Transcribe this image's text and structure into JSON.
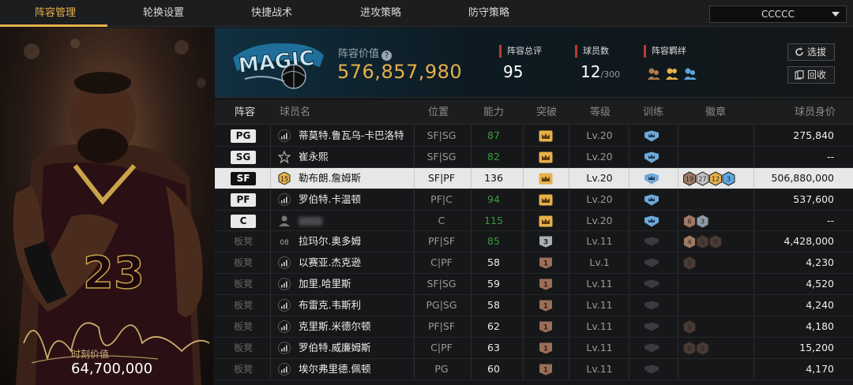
{
  "nav": {
    "tabs": [
      "阵容管理",
      "轮换设置",
      "快捷战术",
      "进攻策略",
      "防守策略"
    ],
    "active_tab": 0,
    "team_select": "CCCCC"
  },
  "featured_player": {
    "jersey": "23",
    "value_label": "时刻价值",
    "value": "64,700,000"
  },
  "header": {
    "logo_text": "MAGIC",
    "value_label": "阵容价值",
    "value": "576,857,980",
    "stats": [
      {
        "label": "阵容总评",
        "value": "95",
        "sub": ""
      },
      {
        "label": "球员数",
        "value": "12",
        "sub": "/300"
      },
      {
        "label": "阵容羁绊",
        "value": "",
        "sub": ""
      }
    ],
    "buttons": {
      "select": "选拔",
      "recycle": "回收"
    }
  },
  "table": {
    "columns": [
      "阵容",
      "球员名",
      "位置",
      "能力",
      "突破",
      "等级",
      "训练",
      "徽章",
      "球员身价"
    ],
    "rows": [
      {
        "slot": "PG",
        "bench": false,
        "name": "蒂莫特.鲁瓦乌-卡巴洛特",
        "pos": "SF|SG",
        "ability": "87",
        "ability_color": "green",
        "breakthrough": "crown",
        "level": "Lv.20",
        "trained": true,
        "badges": [],
        "price": "275,840"
      },
      {
        "slot": "SG",
        "bench": false,
        "name": "崔永熙",
        "pos": "SF|SG",
        "ability": "82",
        "ability_color": "green",
        "breakthrough": "crown",
        "level": "Lv.20",
        "trained": true,
        "badges": [],
        "price": "--"
      },
      {
        "slot": "SF",
        "bench": false,
        "name": "勒布朗.詹姆斯",
        "pos": "SF|PF",
        "ability": "136",
        "ability_color": "white",
        "breakthrough": "crown",
        "level": "Lv.20",
        "trained": true,
        "badges": [
          "19",
          "27",
          "12",
          "3"
        ],
        "price": "506,880,000",
        "selected": true
      },
      {
        "slot": "PF",
        "bench": false,
        "name": "罗伯特.卡温顿",
        "pos": "PF|C",
        "ability": "94",
        "ability_color": "green",
        "breakthrough": "crown",
        "level": "Lv.20",
        "trained": true,
        "badges": [],
        "price": "537,600"
      },
      {
        "slot": "C",
        "bench": false,
        "name": "",
        "pos": "C",
        "ability": "115",
        "ability_color": "green",
        "breakthrough": "crown",
        "level": "Lv.20",
        "trained": true,
        "badges": [
          "6",
          "3"
        ],
        "price": "--"
      },
      {
        "slot": "板凳",
        "bench": true,
        "name": "拉玛尔.奥多姆",
        "pos": "PF|SF",
        "ability": "85",
        "ability_color": "green",
        "breakthrough": "3",
        "level": "Lv.11",
        "trained": false,
        "badges": [
          "4",
          "0",
          "0"
        ],
        "price": "4,428,000",
        "icon_text": "08"
      },
      {
        "slot": "板凳",
        "bench": true,
        "name": "以赛亚.杰克逊",
        "pos": "C|PF",
        "ability": "58",
        "ability_color": "white",
        "breakthrough": "1",
        "level": "Lv.1",
        "trained": false,
        "badges": [
          "0"
        ],
        "price": "4,230"
      },
      {
        "slot": "板凳",
        "bench": true,
        "name": "加里.哈里斯",
        "pos": "SF|SG",
        "ability": "59",
        "ability_color": "white",
        "breakthrough": "1",
        "level": "Lv.11",
        "trained": false,
        "badges": [],
        "price": "4,520"
      },
      {
        "slot": "板凳",
        "bench": true,
        "name": "布雷克.韦斯利",
        "pos": "PG|SG",
        "ability": "58",
        "ability_color": "white",
        "breakthrough": "1",
        "level": "Lv.11",
        "trained": false,
        "badges": [],
        "price": "4,240"
      },
      {
        "slot": "板凳",
        "bench": true,
        "name": "克里斯.米德尔顿",
        "pos": "PF|SF",
        "ability": "62",
        "ability_color": "white",
        "breakthrough": "1",
        "level": "Lv.11",
        "trained": false,
        "badges": [
          "0"
        ],
        "price": "4,180"
      },
      {
        "slot": "板凳",
        "bench": true,
        "name": "罗伯特.威廉姆斯",
        "pos": "C|PF",
        "ability": "63",
        "ability_color": "white",
        "breakthrough": "1",
        "level": "Lv.11",
        "trained": false,
        "badges": [
          "0",
          "0"
        ],
        "price": "15,200"
      },
      {
        "slot": "板凳",
        "bench": true,
        "name": "埃尔弗里德.佩顿",
        "pos": "PG",
        "ability": "60",
        "ability_color": "white",
        "breakthrough": "1",
        "level": "Lv.11",
        "trained": false,
        "badges": [],
        "price": "4,170"
      }
    ]
  }
}
